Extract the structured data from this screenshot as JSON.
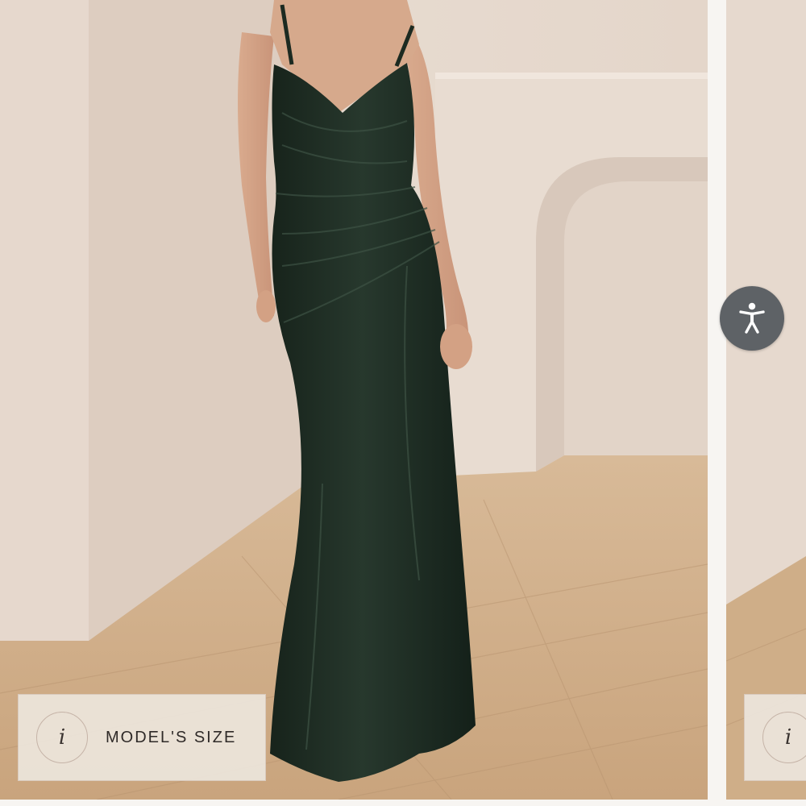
{
  "product_gallery": {
    "main_slide": {
      "image_alt": "Model wearing long dark green velvet dress with thin straps",
      "size_chip": {
        "info_glyph": "i",
        "label": "MODEL'S SIZE"
      }
    },
    "next_slide": {
      "size_chip": {
        "info_glyph": "i"
      }
    }
  },
  "accessibility_widget": {
    "icon": "accessibility-person-icon"
  },
  "colors": {
    "wall": "#e9ddd3",
    "floor": "#cfae88",
    "dress": "#1d2b22",
    "chip_bg": "#ece5dc",
    "a11y_button": "#5e6266"
  }
}
